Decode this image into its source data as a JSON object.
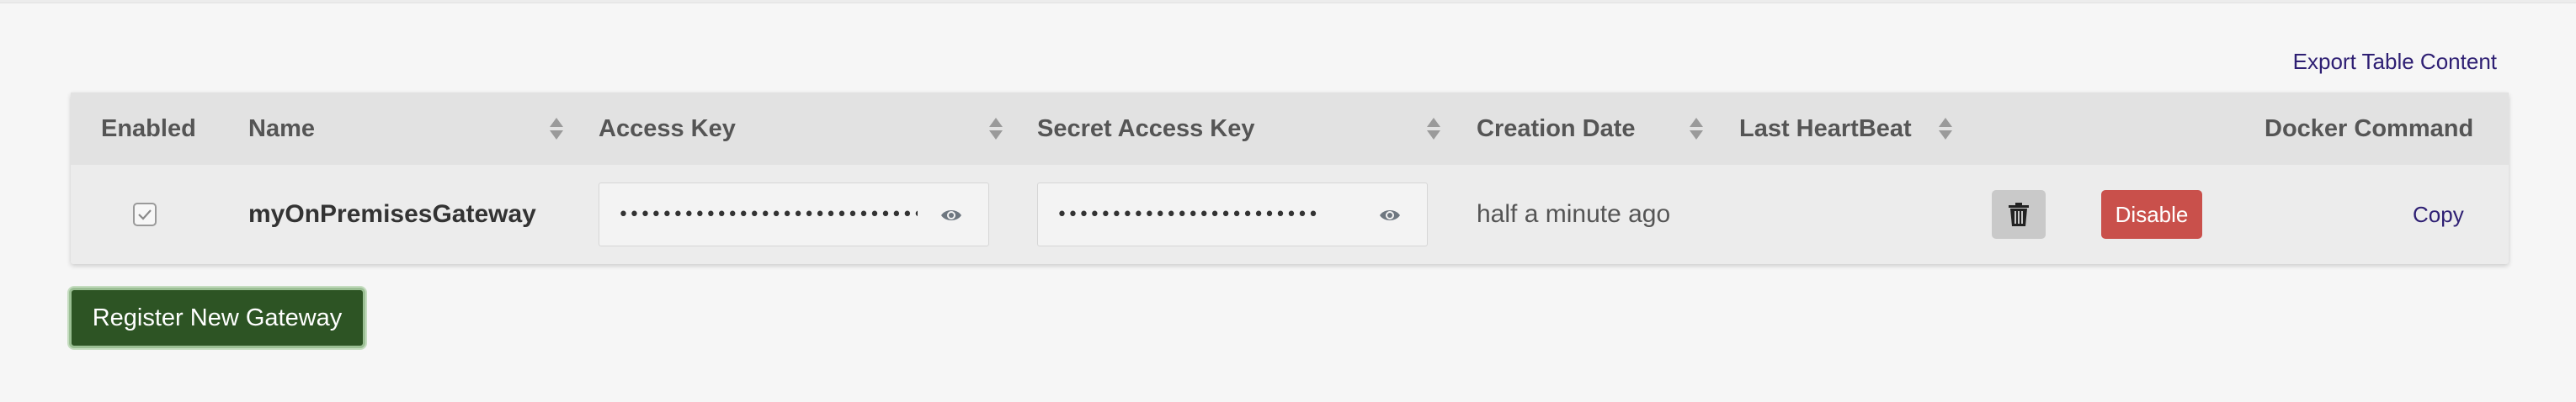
{
  "toolbar": {
    "export_label": "Export Table Content"
  },
  "table": {
    "headers": {
      "enabled": "Enabled",
      "name": "Name",
      "access_key": "Access Key",
      "secret_access_key": "Secret Access Key",
      "creation_date": "Creation Date",
      "last_heartbeat": "Last HeartBeat",
      "docker_command": "Docker Command"
    },
    "rows": [
      {
        "enabled": true,
        "name": "myOnPremisesGateway",
        "access_key": "•••••••••••••••••••••••••••••••••••",
        "secret_access_key": "••••••••••••••••••••••••••••••",
        "creation_date": "half a minute ago",
        "last_heartbeat": "",
        "disable_label": "Disable",
        "copy_label": "Copy"
      }
    ]
  },
  "actions": {
    "register_label": "Register New Gateway"
  },
  "icons": {
    "sort": "sort-icon",
    "eye": "eye-icon",
    "trash": "trash-icon",
    "check": "checkbox-check-icon"
  },
  "colors": {
    "link": "#2e1f73",
    "disable_button": "#c9504b",
    "register_button": "#2d5424",
    "header_bg": "#e2e2e2",
    "row_bg": "#ececec"
  }
}
